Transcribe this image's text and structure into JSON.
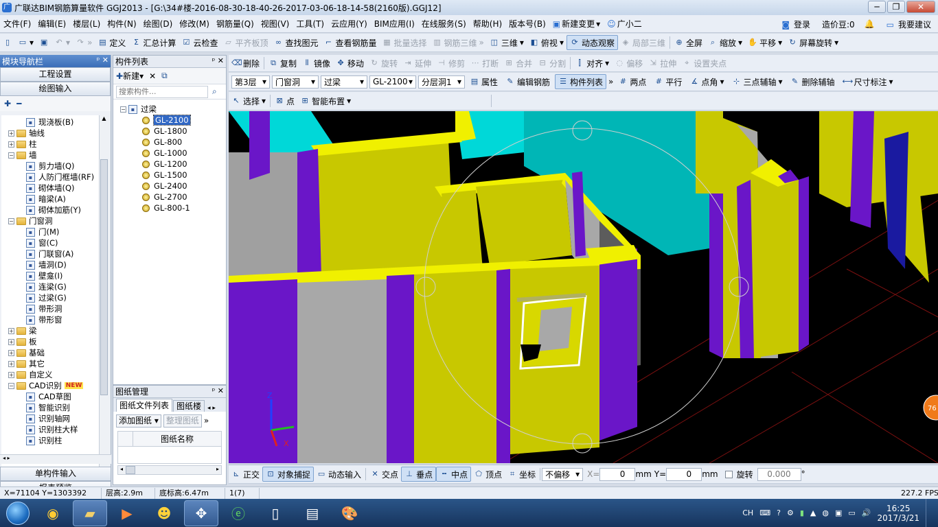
{
  "window": {
    "title": "广联达BIM钢筋算量软件 GGJ2013 - [G:\\34#楼-2016-08-30-18-40-26-2017-03-06-18-14-58(2160版).GGJ12]",
    "min": "─",
    "max": "❐",
    "close": "✕"
  },
  "menu": {
    "items": [
      "文件(F)",
      "编辑(E)",
      "楼层(L)",
      "构件(N)",
      "绘图(D)",
      "修改(M)",
      "钢筋量(Q)",
      "视图(V)",
      "工具(T)",
      "云应用(Y)",
      "BIM应用(I)",
      "在线服务(S)",
      "帮助(H)",
      "版本号(B)"
    ],
    "new_change": "新建变更",
    "xiaoer": "广小二",
    "login": "登录",
    "cost_beans": "造价豆:0",
    "suggest": "我要建议"
  },
  "toolbar1": {
    "define": "定义",
    "summary": "汇总计算",
    "cloud_check": "云检查",
    "flat_top": "平齐板顶",
    "find": "查找图元",
    "view_rebar": "查看钢筋量",
    "batch_select": "批量选择",
    "rebar_3d": "钢筋三维",
    "view_3d": "三维",
    "top_view": "俯视",
    "dynamic_view": "动态观察",
    "partial_3d": "局部三维",
    "fullscreen": "全屏",
    "zoom": "缩放",
    "pan": "平移",
    "screen_rotate": "屏幕旋转"
  },
  "toolbar2": {
    "delete": "删除",
    "copy": "复制",
    "mirror": "镜像",
    "move": "移动",
    "rotate": "旋转",
    "extend": "延伸",
    "trim": "修剪",
    "break": "打断",
    "merge": "合并",
    "split": "分割",
    "align": "对齐",
    "offset": "偏移",
    "stretch": "拉伸",
    "set_point": "设置夹点"
  },
  "toolbar3": {
    "floor": "第3层",
    "category": "门窗洞",
    "type": "过梁",
    "component": "GL-2100",
    "layer": "分层洞1",
    "property": "属性",
    "edit_rebar": "编辑钢筋",
    "comp_list": "构件列表",
    "two_point": "两点",
    "parallel": "平行",
    "point_angle": "点角",
    "three_point_aux": "三点辅轴",
    "delete_aux": "删除辅轴",
    "dim": "尺寸标注"
  },
  "toolbar4": {
    "select": "选择",
    "point": "点",
    "smart_layout": "智能布置"
  },
  "nav": {
    "title": "模块导航栏",
    "project_settings": "工程设置",
    "drawing_input": "绘图输入",
    "single_input": "单构件输入",
    "report_preview": "报表预览",
    "tree": [
      {
        "label": "现浇板(B)",
        "level": 2
      },
      {
        "label": "轴线",
        "level": 1,
        "folder": true
      },
      {
        "label": "柱",
        "level": 1,
        "folder": true
      },
      {
        "label": "墙",
        "level": 1,
        "folder": true,
        "open": true
      },
      {
        "label": "剪力墙(Q)",
        "level": 2
      },
      {
        "label": "人防门框墙(RF)",
        "level": 2
      },
      {
        "label": "砌体墙(Q)",
        "level": 2
      },
      {
        "label": "暗梁(A)",
        "level": 2
      },
      {
        "label": "砌体加筋(Y)",
        "level": 2
      },
      {
        "label": "门窗洞",
        "level": 1,
        "folder": true,
        "open": true
      },
      {
        "label": "门(M)",
        "level": 2
      },
      {
        "label": "窗(C)",
        "level": 2
      },
      {
        "label": "门联窗(A)",
        "level": 2
      },
      {
        "label": "墙洞(D)",
        "level": 2
      },
      {
        "label": "壁龛(I)",
        "level": 2
      },
      {
        "label": "连梁(G)",
        "level": 2
      },
      {
        "label": "过梁(G)",
        "level": 2
      },
      {
        "label": "带形洞",
        "level": 2
      },
      {
        "label": "带形窗",
        "level": 2
      },
      {
        "label": "梁",
        "level": 1,
        "folder": true
      },
      {
        "label": "板",
        "level": 1,
        "folder": true
      },
      {
        "label": "基础",
        "level": 1,
        "folder": true
      },
      {
        "label": "其它",
        "level": 1,
        "folder": true
      },
      {
        "label": "自定义",
        "level": 1,
        "folder": true
      },
      {
        "label": "CAD识别",
        "level": 1,
        "folder": true,
        "open": true,
        "badge": "NEW"
      },
      {
        "label": "CAD草图",
        "level": 2
      },
      {
        "label": "智能识别",
        "level": 2
      },
      {
        "label": "识别轴网",
        "level": 2
      },
      {
        "label": "识别柱大样",
        "level": 2
      },
      {
        "label": "识别柱",
        "level": 2
      }
    ]
  },
  "comp_panel": {
    "title": "构件列表",
    "new": "新建",
    "search_placeholder": "搜索构件...",
    "root": "过梁",
    "items": [
      "GL-2100",
      "GL-1800",
      "GL-800",
      "GL-1000",
      "GL-1200",
      "GL-1500",
      "GL-2400",
      "GL-2700",
      "GL-800-1"
    ],
    "selected": "GL-2100"
  },
  "drawing_panel": {
    "title": "图纸管理",
    "tab1": "图纸文件列表",
    "tab2": "图纸楼",
    "add": "添加图纸",
    "organize": "整理图纸",
    "col": "图纸名称"
  },
  "snapbar": {
    "ortho": "正交",
    "obj_snap": "对象捕捉",
    "dyn_input": "动态输入",
    "intersect": "交点",
    "perp": "垂点",
    "mid": "中点",
    "vertex": "顶点",
    "coord": "坐标",
    "offset_mode": "不偏移",
    "x_label": "X=",
    "x_val": "0",
    "mm1": "mm",
    "y_label": "Y=",
    "y_val": "0",
    "mm2": "mm",
    "rotate": "旋转",
    "rotate_val": "0.000",
    "deg": "°"
  },
  "status": {
    "coords": "X=71104 Y=1303392",
    "floor_height": "层高:2.9m",
    "base_elev": "底标高:6.47m",
    "count": "1(7)",
    "fps": "227.2 FPS"
  },
  "viewport": {
    "axis_z": "Z",
    "axis_x": "X",
    "badge": "76"
  },
  "taskbar": {
    "lang": "CH",
    "time": "16:25",
    "date": "2017/3/21"
  }
}
